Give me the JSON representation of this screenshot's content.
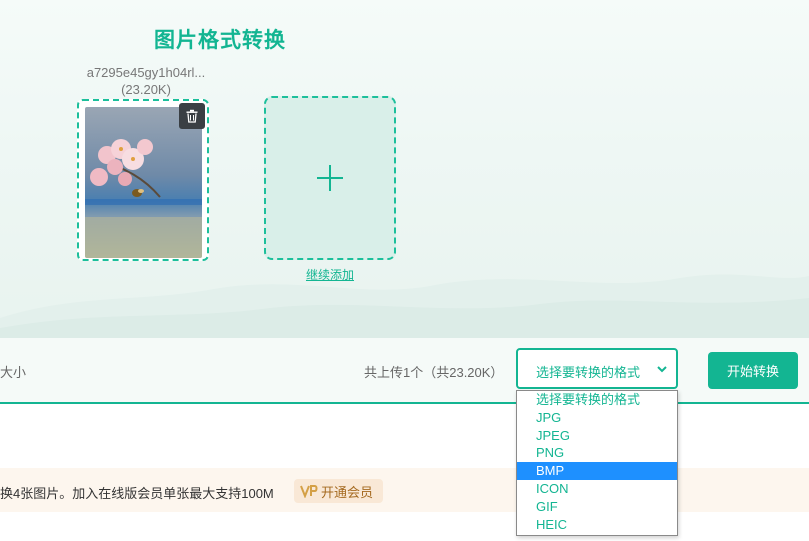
{
  "page": {
    "title": "图片格式转换"
  },
  "upload": {
    "file_name": "a7295e45gy1h04rl...",
    "file_size": "(23.20K)",
    "add_more_label": "继续添加"
  },
  "toolbar": {
    "left_hint": "大小",
    "summary": "共上传1个（共23.20K）",
    "format_select_value": "选择要转换的格式",
    "start_label": "开始转换"
  },
  "dropdown": {
    "options": [
      "选择要转换的格式",
      "JPG",
      "JPEG",
      "PNG",
      "BMP",
      "ICON",
      "GIF",
      "HEIC"
    ],
    "highlighted": "BMP"
  },
  "notice": {
    "text": "换4张图片。加入在线版会员单张最大支持100M",
    "vip_label": "开通会员"
  },
  "colors": {
    "accent": "#13b592",
    "highlight": "#1e90ff",
    "notice_bg": "#fdf6ee",
    "vip_text": "#a56a20"
  },
  "icons": {
    "delete": "trash-icon",
    "add": "plus-icon",
    "select": "chevron-down-icon",
    "vip": "vip-badge-icon"
  }
}
